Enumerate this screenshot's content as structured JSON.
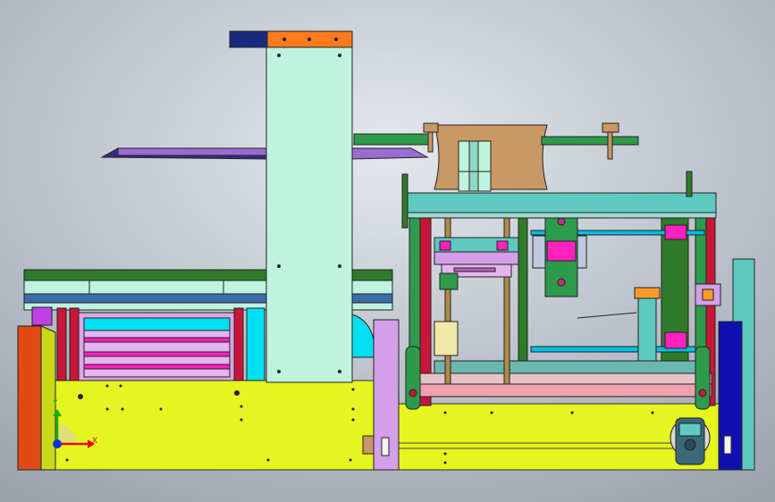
{
  "viewport": {
    "background_top": "#e4e8ee",
    "background_bottom": "#9aa1ab"
  },
  "triad": {
    "x_label": "X",
    "y_label": "Y",
    "x_color": "#e01010",
    "y_color": "#10b010",
    "z_color": "#1030e0"
  },
  "palette": {
    "base": "#e6f41f",
    "column": "#bff2df",
    "cap": "#ff7a1c",
    "navy": "#1a2a80",
    "purple": "#9b6bd1",
    "green": "#2e9a4c",
    "teal": "#5ec9c1",
    "tan": "#c99864",
    "magenta": "#ff20c0",
    "pink": "#f2a0b0",
    "dark_green": "#2f7a2b",
    "cyan": "#00e0f0",
    "orange_red": "#e04a14",
    "blue": "#1010b0",
    "lavender": "#d49ee8",
    "red": "#c8163a"
  }
}
